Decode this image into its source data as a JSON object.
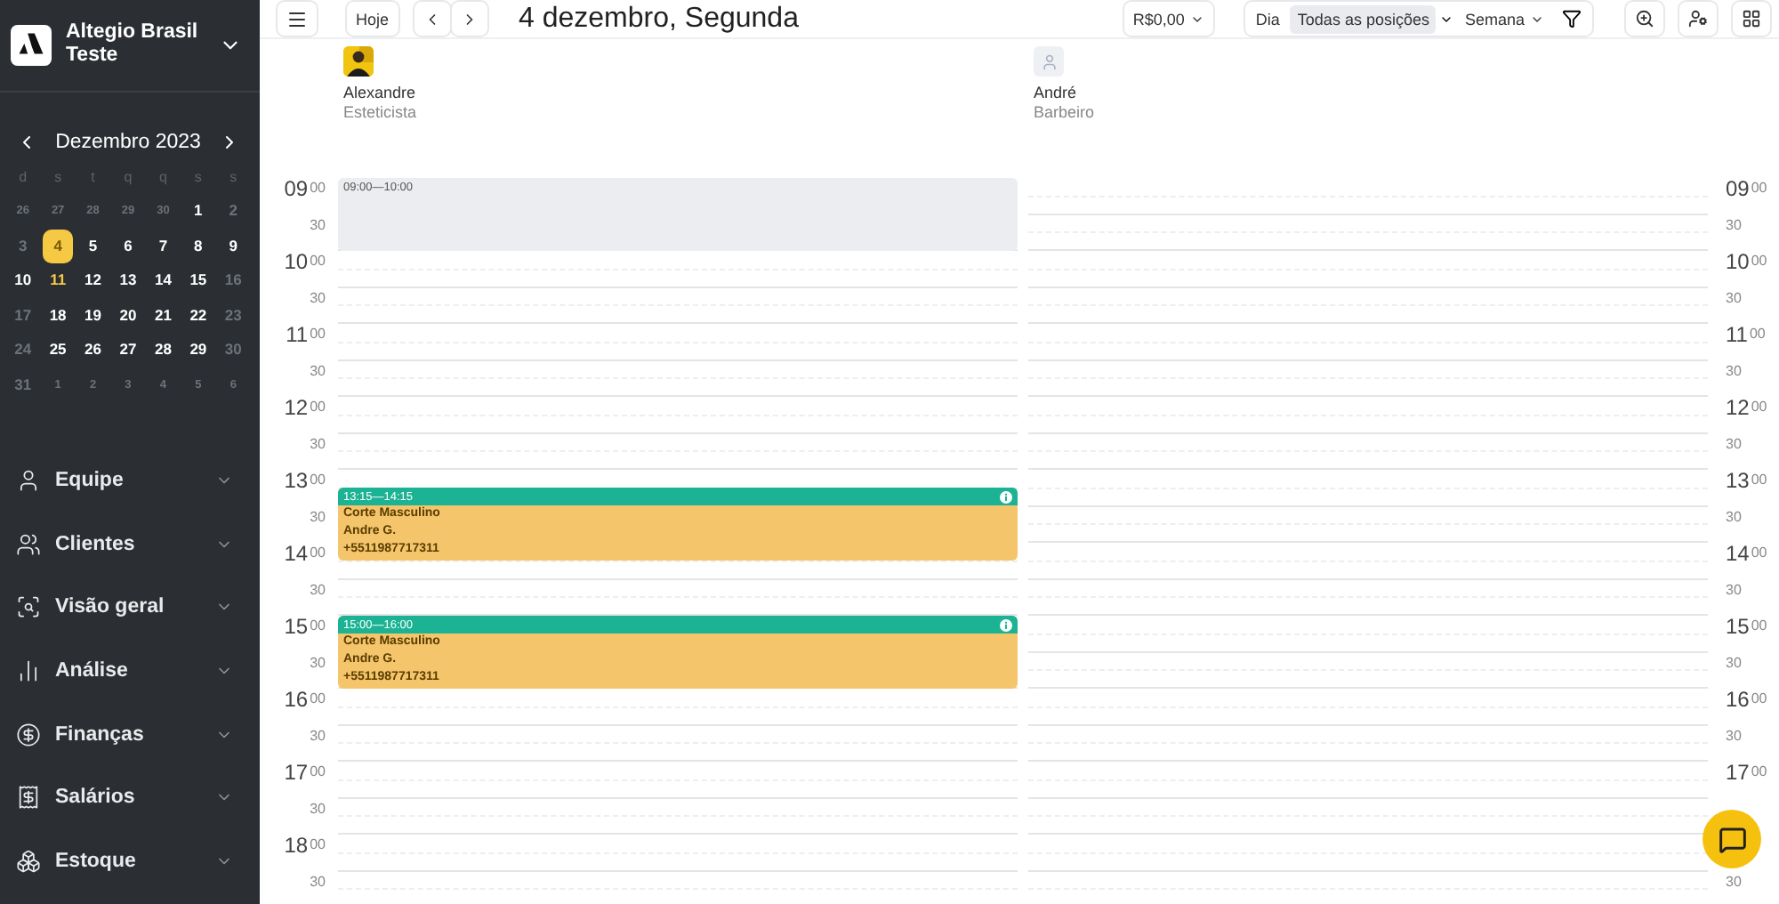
{
  "company": {
    "name": "Altegio Brasil Teste"
  },
  "mini_calendar": {
    "month": "Dezembro 2023",
    "weekdays": [
      "d",
      "s",
      "t",
      "q",
      "q",
      "s",
      "s"
    ],
    "days": [
      {
        "text": "26",
        "kind": "outside",
        "selected": false,
        "today": false
      },
      {
        "text": "27",
        "kind": "outside",
        "selected": false,
        "today": false
      },
      {
        "text": "28",
        "kind": "outside",
        "selected": false,
        "today": false
      },
      {
        "text": "29",
        "kind": "outside",
        "selected": false,
        "today": false
      },
      {
        "text": "30",
        "kind": "outside",
        "selected": false,
        "today": false
      },
      {
        "text": "1",
        "kind": "weekday",
        "selected": false,
        "today": false
      },
      {
        "text": "2",
        "kind": "weekend",
        "selected": false,
        "today": false
      },
      {
        "text": "3",
        "kind": "weekend",
        "selected": false,
        "today": false
      },
      {
        "text": "4",
        "kind": "weekday",
        "selected": true,
        "today": false
      },
      {
        "text": "5",
        "kind": "weekday",
        "selected": false,
        "today": false
      },
      {
        "text": "6",
        "kind": "weekday",
        "selected": false,
        "today": false
      },
      {
        "text": "7",
        "kind": "weekday",
        "selected": false,
        "today": false
      },
      {
        "text": "8",
        "kind": "weekday",
        "selected": false,
        "today": false
      },
      {
        "text": "9",
        "kind": "weekday",
        "selected": false,
        "today": false
      },
      {
        "text": "10",
        "kind": "weekday",
        "selected": false,
        "today": false
      },
      {
        "text": "11",
        "kind": "weekday",
        "selected": false,
        "today": true
      },
      {
        "text": "12",
        "kind": "weekday",
        "selected": false,
        "today": false
      },
      {
        "text": "13",
        "kind": "weekday",
        "selected": false,
        "today": false
      },
      {
        "text": "14",
        "kind": "weekday",
        "selected": false,
        "today": false
      },
      {
        "text": "15",
        "kind": "weekday",
        "selected": false,
        "today": false
      },
      {
        "text": "16",
        "kind": "weekend",
        "selected": false,
        "today": false
      },
      {
        "text": "17",
        "kind": "weekend",
        "selected": false,
        "today": false
      },
      {
        "text": "18",
        "kind": "weekday",
        "selected": false,
        "today": false
      },
      {
        "text": "19",
        "kind": "weekday",
        "selected": false,
        "today": false
      },
      {
        "text": "20",
        "kind": "weekday",
        "selected": false,
        "today": false
      },
      {
        "text": "21",
        "kind": "weekday",
        "selected": false,
        "today": false
      },
      {
        "text": "22",
        "kind": "weekday",
        "selected": false,
        "today": false
      },
      {
        "text": "23",
        "kind": "weekend",
        "selected": false,
        "today": false
      },
      {
        "text": "24",
        "kind": "weekend",
        "selected": false,
        "today": false
      },
      {
        "text": "25",
        "kind": "weekday",
        "selected": false,
        "today": false
      },
      {
        "text": "26",
        "kind": "weekday",
        "selected": false,
        "today": false
      },
      {
        "text": "27",
        "kind": "weekday",
        "selected": false,
        "today": false
      },
      {
        "text": "28",
        "kind": "weekday",
        "selected": false,
        "today": false
      },
      {
        "text": "29",
        "kind": "weekday",
        "selected": false,
        "today": false
      },
      {
        "text": "30",
        "kind": "weekend",
        "selected": false,
        "today": false
      },
      {
        "text": "31",
        "kind": "weekend",
        "selected": false,
        "today": false
      },
      {
        "text": "1",
        "kind": "outside",
        "selected": false,
        "today": false
      },
      {
        "text": "2",
        "kind": "outside",
        "selected": false,
        "today": false
      },
      {
        "text": "3",
        "kind": "outside",
        "selected": false,
        "today": false
      },
      {
        "text": "4",
        "kind": "outside",
        "selected": false,
        "today": false
      },
      {
        "text": "5",
        "kind": "outside",
        "selected": false,
        "today": false
      },
      {
        "text": "6",
        "kind": "outside",
        "selected": false,
        "today": false
      }
    ]
  },
  "nav": [
    {
      "label": "Equipe",
      "kind": "team"
    },
    {
      "label": "Clientes",
      "kind": "clients"
    },
    {
      "label": "Visão geral",
      "kind": "overview"
    },
    {
      "label": "Análise",
      "kind": "analytics"
    },
    {
      "label": "Finanças",
      "kind": "finance"
    },
    {
      "label": "Salários",
      "kind": "salary"
    },
    {
      "label": "Estoque",
      "kind": "stock"
    }
  ],
  "toolbar": {
    "today": "Hoje",
    "title": "4 dezembro, Segunda",
    "amount": "R$0,00",
    "views": [
      {
        "label": "Dia",
        "selected": false
      },
      {
        "label": "Todas as posições",
        "selected": true
      }
    ],
    "period": "Semana"
  },
  "staff": [
    {
      "name": "Alexandre",
      "role": "Esteticista",
      "events": [
        {
          "kind": "blocked",
          "time": "09:00—10:00"
        },
        {
          "kind": "appointment",
          "time": "13:15—14:15",
          "service": "Corte Masculino",
          "client": "Andre G.",
          "phone": "+5511987717311"
        },
        {
          "kind": "appointment",
          "time": "15:00—16:00",
          "service": "Corte Masculino",
          "client": "Andre G.",
          "phone": "+5511987717311"
        }
      ]
    },
    {
      "name": "André",
      "role": "Barbeiro",
      "kind": "placeholder"
    }
  ],
  "time_axis_left": [
    {
      "hour": "09",
      "minute": "00"
    },
    {
      "minute": "30"
    },
    {
      "hour": "10",
      "minute": "00"
    },
    {
      "minute": "30"
    },
    {
      "hour": "11",
      "minute": "00"
    },
    {
      "minute": "30"
    },
    {
      "hour": "12",
      "minute": "00"
    },
    {
      "minute": "30"
    },
    {
      "hour": "13",
      "minute": "00"
    },
    {
      "minute": "30"
    },
    {
      "hour": "14",
      "minute": "00"
    },
    {
      "minute": "30"
    },
    {
      "hour": "15",
      "minute": "00"
    },
    {
      "minute": "30"
    },
    {
      "hour": "16",
      "minute": "00"
    },
    {
      "minute": "30"
    },
    {
      "hour": "17",
      "minute": "00"
    },
    {
      "minute": "30"
    },
    {
      "hour": "18",
      "minute": "00"
    },
    {
      "minute": "30"
    }
  ],
  "time_axis_right": [
    {
      "hour": "09",
      "minute": "00"
    },
    {
      "minute": "30"
    },
    {
      "hour": "10",
      "minute": "00"
    },
    {
      "minute": "30"
    },
    {
      "hour": "11",
      "minute": "00"
    },
    {
      "minute": "30"
    },
    {
      "hour": "12",
      "minute": "00"
    },
    {
      "minute": "30"
    },
    {
      "hour": "13",
      "minute": "00"
    },
    {
      "minute": "30"
    },
    {
      "hour": "14",
      "minute": "00"
    },
    {
      "minute": "30"
    },
    {
      "hour": "15",
      "minute": "00"
    },
    {
      "minute": "30"
    },
    {
      "hour": "16",
      "minute": "00"
    },
    {
      "minute": "30"
    },
    {
      "hour": "17",
      "minute": "00"
    },
    {
      "covered": true
    },
    {
      "covered": true
    },
    {
      "minute": "30"
    }
  ]
}
